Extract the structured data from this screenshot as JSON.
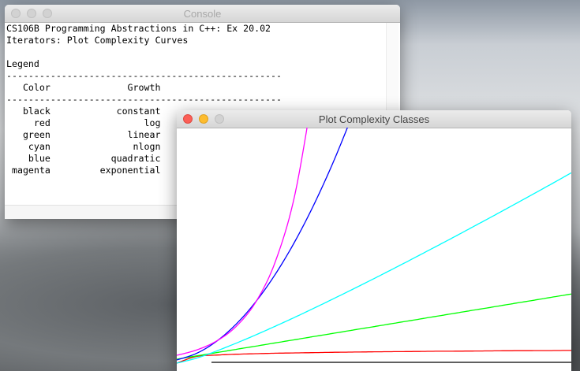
{
  "console": {
    "title": "Console",
    "lines": [
      "CS106B Programming Abstractions in C++: Ex 20.02",
      "Iterators: Plot Complexity Curves",
      "",
      "Legend",
      "--------------------------------------------------",
      "   Color              Growth",
      "--------------------------------------------------",
      "   black            constant",
      "     red                 log",
      "   green              linear",
      "    cyan               nlogn",
      "    blue           quadratic",
      " magenta         exponential"
    ]
  },
  "plot_window": {
    "title": "Plot Complexity Classes"
  },
  "chart_data": {
    "type": "line",
    "title": "Plot Complexity Classes",
    "xlabel": "",
    "ylabel": "",
    "xlim": [
      0,
      500
    ],
    "ylim": [
      0,
      300
    ],
    "grid": false,
    "x": [
      0,
      25,
      50,
      75,
      100,
      125,
      150,
      175,
      200,
      225,
      250,
      275,
      300,
      325,
      350,
      375,
      400,
      425,
      450,
      475,
      500
    ],
    "series": [
      {
        "name": "constant",
        "color": "#000000",
        "x_start": 44,
        "values": [
          1,
          1,
          1,
          1,
          1,
          1,
          1,
          1,
          1,
          1,
          1,
          1,
          1,
          1,
          1,
          1,
          1,
          1,
          1,
          1,
          1
        ]
      },
      {
        "name": "log",
        "color": "#ff0000",
        "values": [
          0,
          8.5,
          10.2,
          11.3,
          12.0,
          12.6,
          13.0,
          13.4,
          13.8,
          14.1,
          14.4,
          14.6,
          14.8,
          15.1,
          15.2,
          15.4,
          15.6,
          15.8,
          15.9,
          16.0,
          16.2
        ]
      },
      {
        "name": "linear",
        "color": "#00ff00",
        "values": [
          5,
          9.2,
          13.3,
          17.5,
          21.6,
          25.8,
          29.9,
          34.1,
          38.2,
          42.4,
          46.5,
          50.7,
          54.8,
          59,
          63.1,
          67.3,
          71.4,
          75.6,
          79.7,
          83.9,
          88
        ]
      },
      {
        "name": "nlogn",
        "color": "#00ffff",
        "values": [
          0,
          6.3,
          15.3,
          25.3,
          35.9,
          47.1,
          58.6,
          70.5,
          82.7,
          95.1,
          107.7,
          120.5,
          133.5,
          146.7,
          159.9,
          173.4,
          186.9,
          200.6,
          214.4,
          228.3,
          242.4
        ]
      },
      {
        "name": "quadratic",
        "color": "#0000ff",
        "values": [
          4,
          12.4,
          27.5,
          49.4,
          78,
          113.4,
          155.5,
          204.4,
          260,
          322
        ]
      },
      {
        "name": "exponential",
        "color": "#ff00ff",
        "values": [
          10,
          16.7,
          27.9,
          46.5,
          77.6,
          129.5,
          216,
          361
        ]
      }
    ]
  }
}
